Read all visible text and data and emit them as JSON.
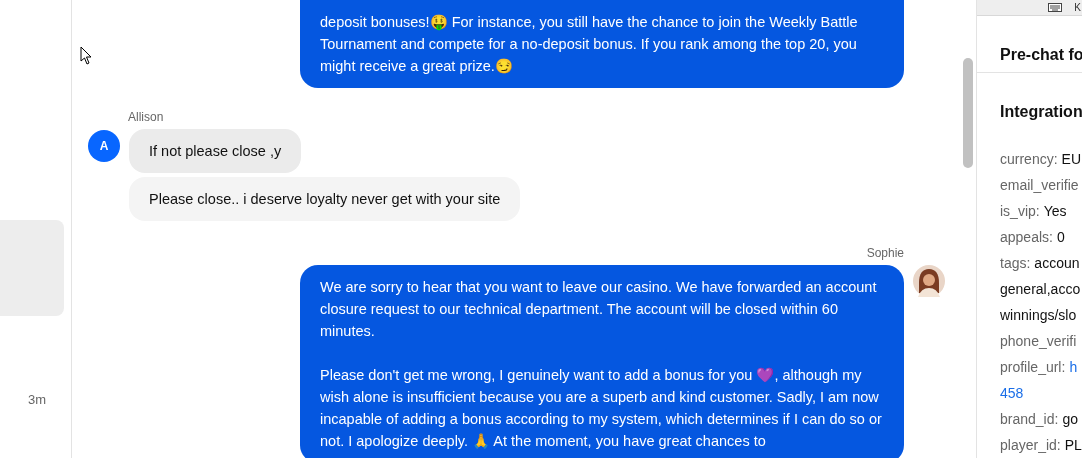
{
  "left_panel": {
    "time": "3m"
  },
  "messages": [
    {
      "kind": "agent",
      "paragraphs": [
        "deposit bonuses!🤑 For instance, you still have the chance to join the Weekly Battle Tournament and compete for a no-deposit bonus. If you rank among the top 20, you might receive a great prize.😏"
      ]
    },
    {
      "kind": "customer",
      "sender": "Allison",
      "avatar_initial": "A",
      "bubbles": [
        "If not please close ,y",
        "Please close.. i deserve loyalty never get with your site"
      ]
    },
    {
      "kind": "agent",
      "sender": "Sophie",
      "paragraphs": [
        "We are sorry to hear that you want to leave our casino. We have forwarded an account closure request to our technical department. The account will be closed within 60 minutes.",
        "Please don't get me wrong, I genuinely want to add a bonus for you 💜, although my wish alone is insufficient because you are a superb and kind customer. Sadly, I am now incapable of adding a bonus according to my system, which determines if I can do so or not. I apologize deeply. 🙏 At the moment, you have great chances to"
      ]
    }
  ],
  "right_panel": {
    "map_key": "K",
    "title": "Pre-chat fo",
    "section_title": "Integration",
    "fields": [
      {
        "label": "currency:",
        "value": [
          "EU"
        ]
      },
      {
        "label": "email_verifie"
      },
      {
        "label": "is_vip:",
        "value": [
          "Yes"
        ]
      },
      {
        "label": "appeals:",
        "value": [
          "0"
        ]
      },
      {
        "label": "tags:",
        "value": [
          "accoun",
          "general,acco",
          "winnings/slo"
        ]
      },
      {
        "label": "phone_verifi"
      },
      {
        "label": "profile_url:",
        "value": [
          "h",
          "458"
        ],
        "kind": "link"
      },
      {
        "label": "brand_id:",
        "value": [
          "go"
        ]
      },
      {
        "label": "player_id:",
        "value": [
          "PL"
        ]
      }
    ]
  }
}
